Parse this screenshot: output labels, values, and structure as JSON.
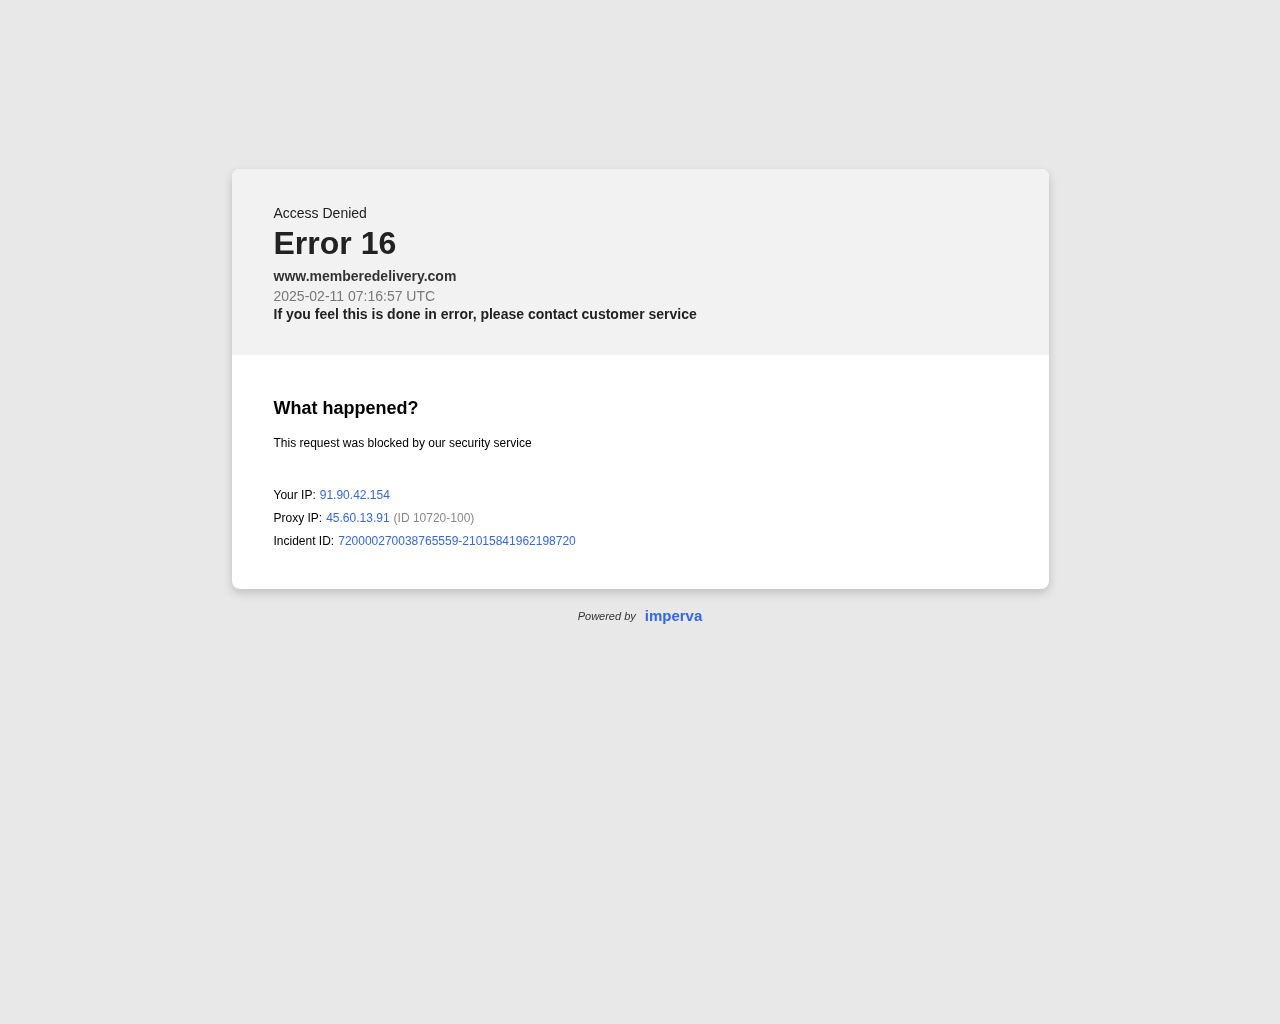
{
  "header": {
    "label": "Access Denied",
    "title": "Error 16",
    "domain": "www.memberedelivery.com",
    "timestamp": "2025-02-11 07:16:57 UTC",
    "message": "If you feel this is done in error, please contact customer service"
  },
  "body": {
    "heading": "What happened?",
    "text": "This request was blocked by our security service",
    "details": [
      {
        "label": "Your IP:",
        "value": "91.90.42.154"
      },
      {
        "label": "Proxy IP:",
        "value": "45.60.13.91",
        "note": "(ID 10720-100)"
      },
      {
        "label": "Incident ID:",
        "value": "720000270038765559-21015841962198720"
      }
    ]
  },
  "footer": {
    "powered": "Powered by",
    "brand": "imperva"
  }
}
